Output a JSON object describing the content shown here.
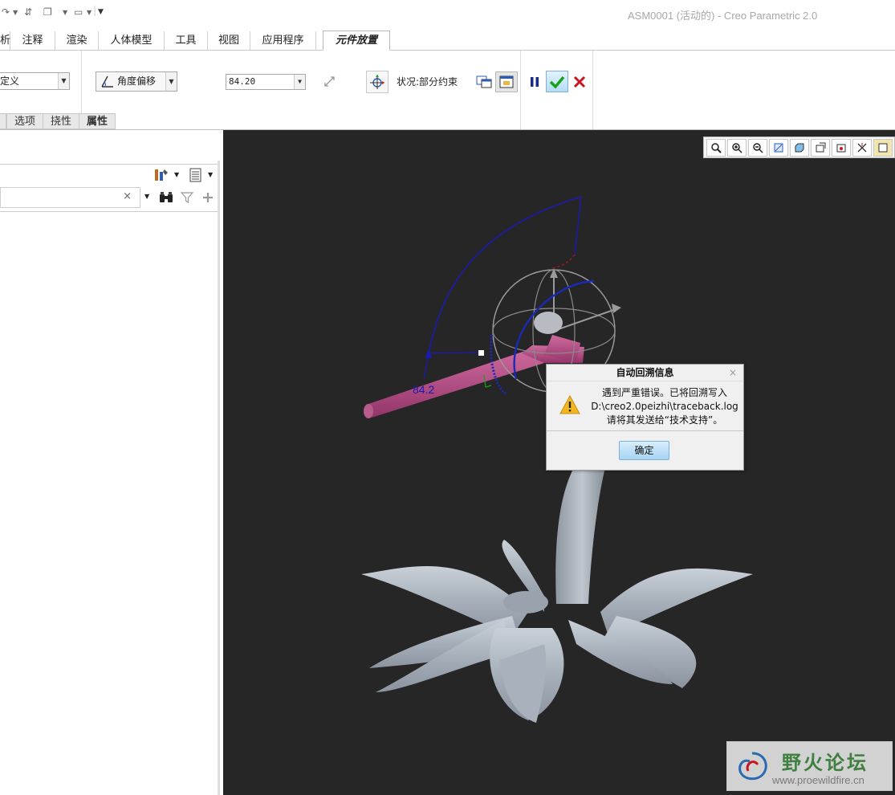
{
  "window": {
    "title": "ASM0001 (活动的) - Creo Parametric 2.0"
  },
  "tabs": [
    {
      "label": "析"
    },
    {
      "label": "注释"
    },
    {
      "label": "渲染"
    },
    {
      "label": "人体模型"
    },
    {
      "label": "工具"
    },
    {
      "label": "视图"
    },
    {
      "label": "应用程序"
    },
    {
      "label": "元件放置"
    }
  ],
  "ribbon": {
    "constraint_set": "定义",
    "constraint_type": "角度偏移",
    "offset_value": "84.20",
    "status": "状况:部分约束"
  },
  "subtabs": [
    {
      "label": "选项"
    },
    {
      "label": "挠性"
    },
    {
      "label": "属性"
    }
  ],
  "tree": {
    "search_clear": "×"
  },
  "viewport": {
    "dimension_label": "84.2"
  },
  "dialog": {
    "title": "自动回溯信息",
    "close": "×",
    "message_line1": "遇到严重错误。已将回溯写入",
    "message_line2": "D:\\creo2.0peizhi\\traceback.log",
    "message_line3": "请将其发送给“技术支持”。",
    "ok_label": "确定"
  },
  "watermark": {
    "name": "野火论坛",
    "url": "www.proewildfire.cn"
  },
  "colors": {
    "viewport_bg": "#262626",
    "accent_green": "#1aa11a",
    "accent_red": "#c8141e",
    "dim_blue": "#1a1ab0",
    "part_pink": "#b4487e"
  }
}
